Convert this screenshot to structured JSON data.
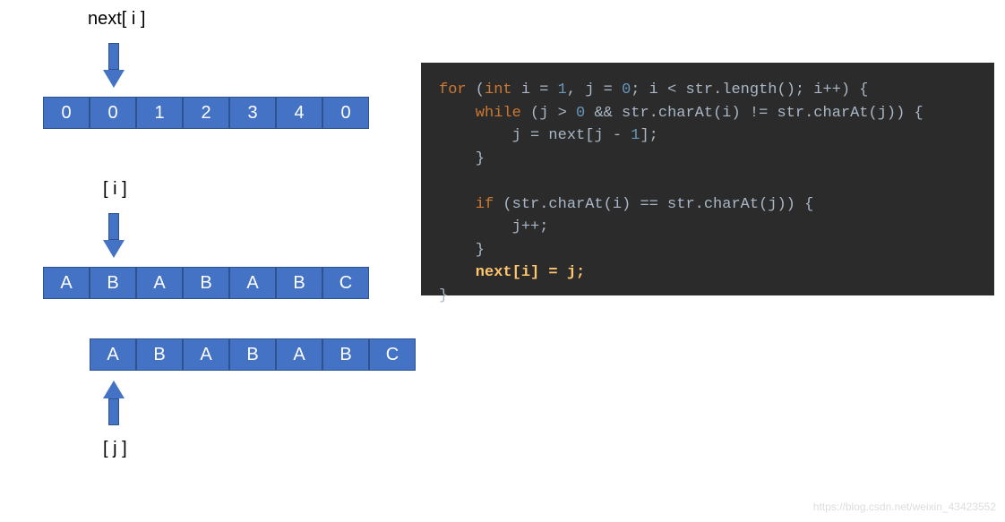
{
  "labels": {
    "next_i": "next[ i ]",
    "i": "[ i ]",
    "j": "[ j ]"
  },
  "arrays": {
    "next": [
      "0",
      "0",
      "1",
      "2",
      "3",
      "4",
      "0"
    ],
    "str_i": [
      "A",
      "B",
      "A",
      "B",
      "A",
      "B",
      "C"
    ],
    "str_j": [
      "A",
      "B",
      "A",
      "B",
      "A",
      "B",
      "C"
    ]
  },
  "code": {
    "line1a": "for",
    "line1b": " (",
    "line1c": "int",
    "line1d": " i = ",
    "line1e": "1",
    "line1f": ", j = ",
    "line1g": "0",
    "line1h": "; i < str.length(); i++) {",
    "line2a": "    while",
    "line2b": " (j > ",
    "line2c": "0",
    "line2d": " && str.charAt(i) != str.charAt(j)) {",
    "line3a": "        j = next[j - ",
    "line3b": "1",
    "line3c": "];",
    "line4": "    }",
    "line5": "",
    "line6a": "    if",
    "line6b": " (str.charAt(i) == str.charAt(j)) {",
    "line7": "        j++;",
    "line8": "    }",
    "line9": "    next[i] = j;",
    "line10": "}"
  },
  "watermark": "https://blog.csdn.net/weixin_43423552"
}
